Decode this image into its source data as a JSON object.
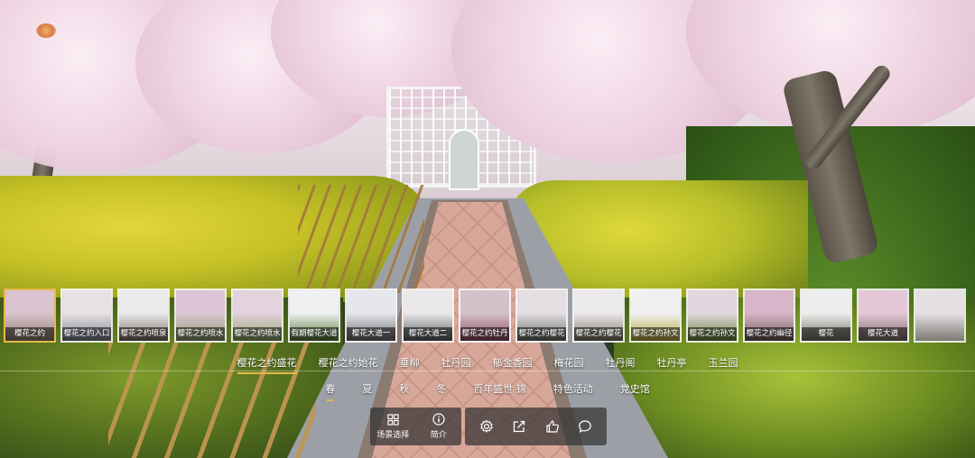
{
  "thumbnails": [
    {
      "caption": "樱花之约",
      "active": true,
      "tone": [
        "#d9c3cf",
        "#8d7e6a"
      ]
    },
    {
      "caption": "樱花之约入口",
      "active": false,
      "tone": [
        "#e7e2e4",
        "#7c8492"
      ]
    },
    {
      "caption": "樱花之约喷泉",
      "active": false,
      "tone": [
        "#eaeaea",
        "#7b6f62"
      ]
    },
    {
      "caption": "樱花之约喷水",
      "active": false,
      "tone": [
        "#dcc6d6",
        "#8e9c6c"
      ]
    },
    {
      "caption": "樱花之约喷水",
      "active": false,
      "tone": [
        "#e5d2df",
        "#8ca466"
      ]
    },
    {
      "caption": "假期樱花大道",
      "active": false,
      "tone": [
        "#eef0f2",
        "#5b7a3a"
      ]
    },
    {
      "caption": "樱花大道一",
      "active": false,
      "tone": [
        "#e6e7ec",
        "#6e6a6c"
      ]
    },
    {
      "caption": "樱花大道二",
      "active": false,
      "tone": [
        "#ebe8ea",
        "#5a5f62"
      ]
    },
    {
      "caption": "樱花之约牡丹",
      "active": false,
      "tone": [
        "#d3c2c9",
        "#8c4a60"
      ]
    },
    {
      "caption": "樱花之约樱花",
      "active": false,
      "tone": [
        "#e4dde2",
        "#6a6f66"
      ]
    },
    {
      "caption": "樱花之约樱花",
      "active": false,
      "tone": [
        "#ece9ec",
        "#7b7466"
      ]
    },
    {
      "caption": "樱花之约孙文",
      "active": false,
      "tone": [
        "#f0f0f0",
        "#b5a83a"
      ]
    },
    {
      "caption": "樱花之约孙文",
      "active": false,
      "tone": [
        "#e2d6df",
        "#6c8a3a"
      ]
    },
    {
      "caption": "樱花之约幽径",
      "active": false,
      "tone": [
        "#d9b5c9",
        "#6e5a5a"
      ]
    },
    {
      "caption": "樱花",
      "active": false,
      "tone": [
        "#eeeeee",
        "#6c7260"
      ]
    },
    {
      "caption": "樱花大道",
      "active": false,
      "tone": [
        "#e4c6d6",
        "#7c6f6a"
      ]
    },
    {
      "caption": "",
      "active": false,
      "tone": [
        "#e6e0e4",
        "#7c7a72"
      ]
    }
  ],
  "categories_primary": [
    {
      "label": "樱花之约盛花",
      "active": true
    },
    {
      "label": "樱花之约始花",
      "active": false
    },
    {
      "label": "垂柳",
      "active": false
    },
    {
      "label": "牡丹园",
      "active": false
    },
    {
      "label": "郁金香园",
      "active": false
    },
    {
      "label": "梅花园",
      "active": false
    },
    {
      "label": "牡丹阁",
      "active": false
    },
    {
      "label": "牡丹亭",
      "active": false
    },
    {
      "label": "玉兰园",
      "active": false
    }
  ],
  "categories_secondary": [
    {
      "label": "春",
      "active": true
    },
    {
      "label": "夏",
      "active": false
    },
    {
      "label": "秋",
      "active": false
    },
    {
      "label": "冬",
      "active": false
    },
    {
      "label": "百年盛世 锦",
      "active": false
    },
    {
      "label": "特色活动",
      "active": false
    },
    {
      "label": "党史馆",
      "active": false
    }
  ],
  "toolbar": {
    "scene_select_label": "场景选择",
    "intro_label": "简介",
    "icons": [
      "settings-icon",
      "share-icon",
      "like-icon",
      "comment-icon"
    ]
  },
  "colors": {
    "accent": "#e8b84a",
    "toolbar_bg": "#323232"
  }
}
